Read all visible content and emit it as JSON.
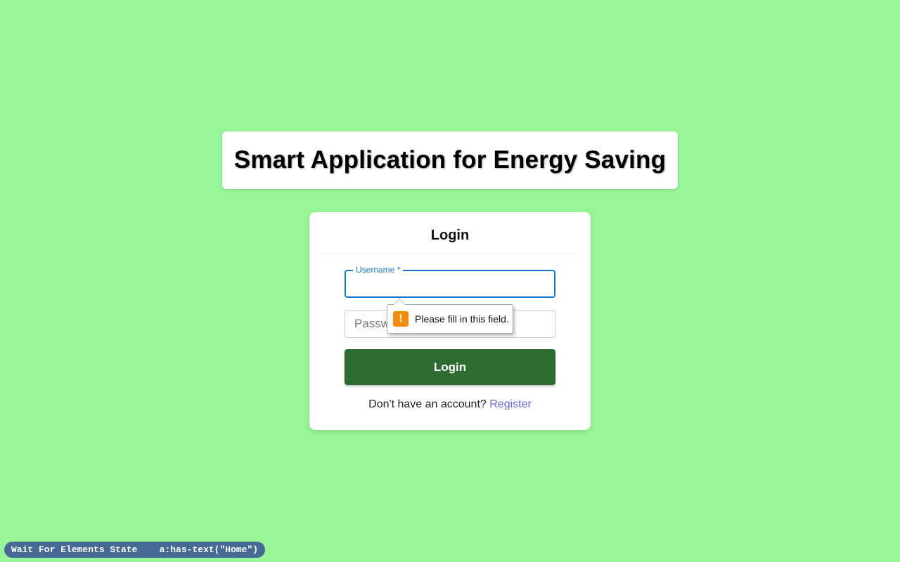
{
  "header": {
    "title": "Smart Application for Energy Saving"
  },
  "login": {
    "heading": "Login",
    "username_label": "Username *",
    "username_value": "",
    "password_placeholder": "Password",
    "button_label": "Login",
    "register_prompt": "Don't have an account?",
    "register_link": "Register"
  },
  "validation_tooltip": {
    "icon": "warning-icon",
    "message": "Please fill in this field."
  },
  "status_bar": {
    "action": "Wait For Elements State",
    "selector": "a:has-text(\"Home\")"
  },
  "colors": {
    "background": "#98f598",
    "button": "#2e6b30",
    "focus_outline": "#1976d2",
    "link": "#6366e0",
    "warning": "#f58a07",
    "status_pill": "#456a95"
  }
}
